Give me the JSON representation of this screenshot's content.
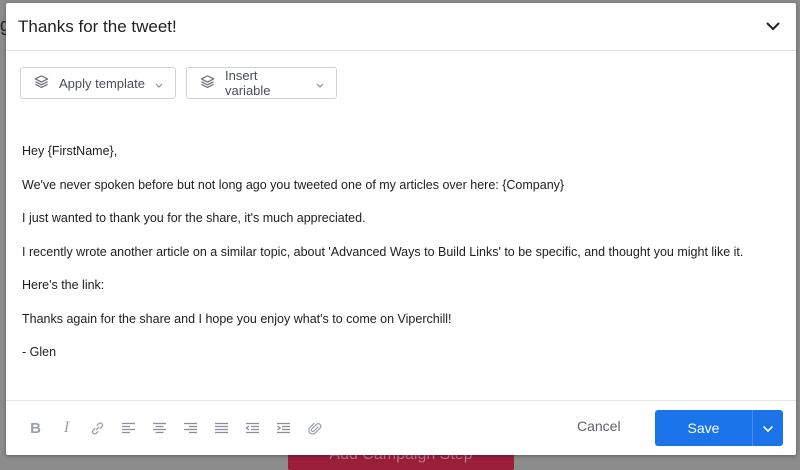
{
  "backdrop": {
    "cta_label": "Add Campaign Step",
    "edge_glyph": "g"
  },
  "modal": {
    "title": "Thanks for the tweet!",
    "collapse_icon": "chevron-down-icon"
  },
  "toolbar": {
    "apply_template": {
      "label": "Apply template",
      "icon": "layers-icon"
    },
    "insert_variable": {
      "label": "Insert variable",
      "icon": "layers-icon"
    }
  },
  "message": {
    "lines": [
      "Hey {FirstName},",
      "We've never spoken before but not long ago you tweeted one of my articles over here: {Company}",
      "I just wanted to thank you for the share, it's much appreciated.",
      "I recently wrote another article on a similar topic, about 'Advanced Ways to Build Links' to be specific, and thought you might like it.",
      "Here's the link:",
      "Thanks again for the share and I hope you enjoy what's to come on Viperchill!",
      "- Glen"
    ]
  },
  "format_tools": {
    "bold": "B",
    "italic": "I",
    "icons": [
      "bold-icon",
      "italic-icon",
      "link-icon",
      "align-left-icon",
      "align-center-icon",
      "align-right-icon",
      "align-justify-icon",
      "outdent-icon",
      "indent-icon",
      "attachment-icon"
    ]
  },
  "footer": {
    "cancel_label": "Cancel",
    "save_label": "Save"
  },
  "colors": {
    "primary": "#1a73e8",
    "backdrop_cta": "#9b1f3a",
    "icon_gray": "#9aa0a6"
  }
}
